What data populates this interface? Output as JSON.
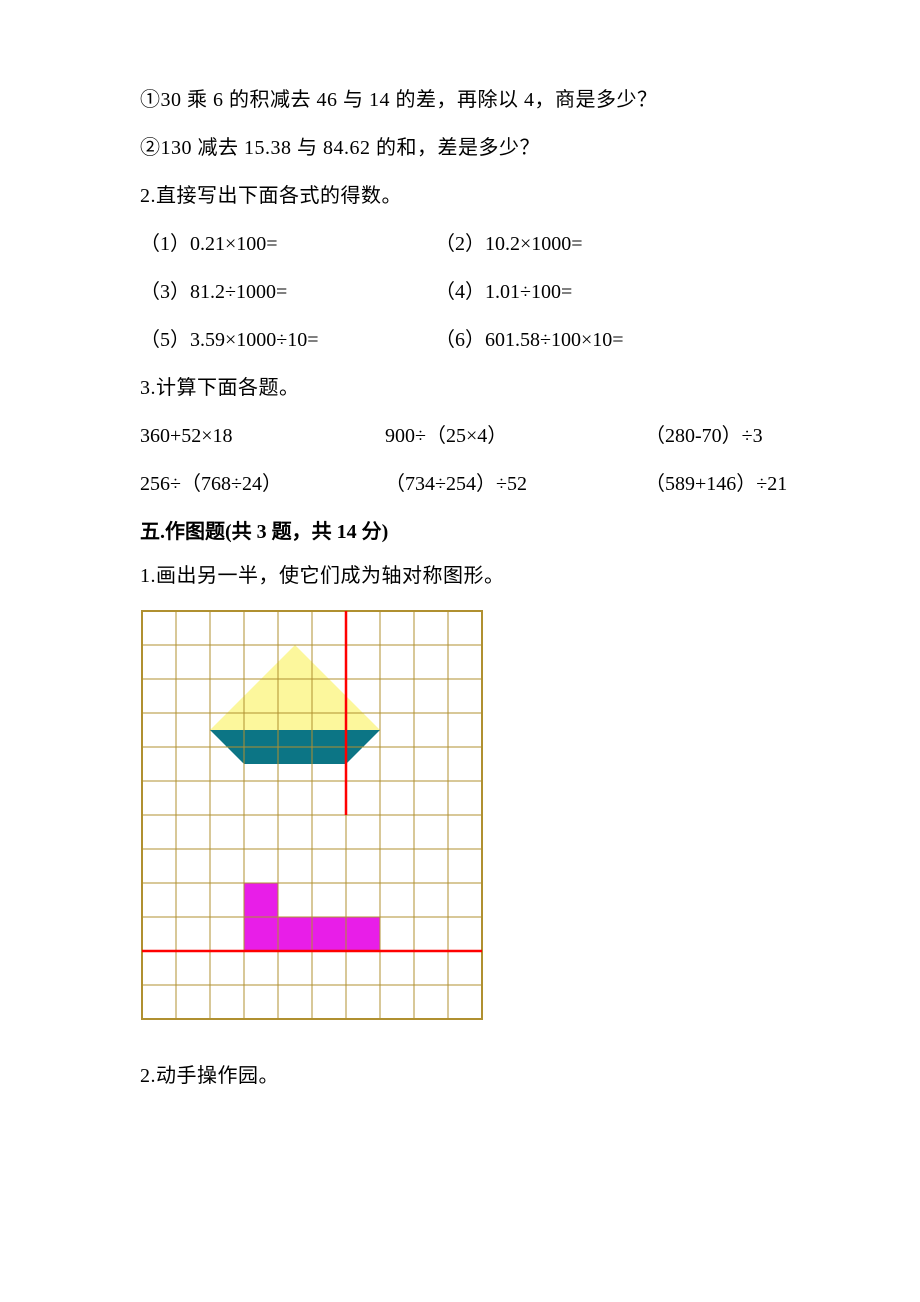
{
  "q1a": "①30 乘 6 的积减去 46 与 14 的差，再除以 4，商是多少？",
  "q1b": "②130 减去 15.38 与 84.62 的和，差是多少？",
  "q2_intro": "2.直接写出下面各式的得数。",
  "q2_1": "（1）0.21×100=",
  "q2_2": "（2）10.2×1000=",
  "q2_3": "（3）81.2÷1000=",
  "q2_4": "（4）1.01÷100=",
  "q2_5": "（5）3.59×1000÷10=",
  "q2_6": "（6）601.58÷100×10=",
  "q3_intro": "3.计算下面各题。",
  "q3_a": "360+52×18",
  "q3_b": "900÷（25×4）",
  "q3_c": "（280-70）÷3",
  "q3_d": "256÷（768÷24）",
  "q3_e": "（734÷254）÷52",
  "q3_f": "（589+146）÷21",
  "section5_heading": "五.作图题(共 3 题，共 14 分)",
  "s5_q1": "1.画出另一半，使它们成为轴对称图形。",
  "s5_q2": "2.动手操作园。",
  "colors": {
    "grid_line": "#b09030",
    "yellow_fill": "#fcf79c",
    "teal_fill": "#0c7585",
    "magenta_fill": "#e81ee8",
    "axis_red": "#ff0000"
  },
  "chart_data": {
    "type": "table",
    "description": "Symmetry drawing grid 10 columns × 12 rows (cell 34px).",
    "shape_A": {
      "note": "Axis of symmetry: vertical red line at column boundary x=6 (from row 0 to row 6).",
      "yellow_triangle_vertices_cells": [
        [
          4.5,
          1
        ],
        [
          2,
          3.5
        ],
        [
          7,
          3.5
        ]
      ],
      "teal_trapezoid_vertices_cells": [
        [
          2,
          3.5
        ],
        [
          7,
          3.5
        ],
        [
          6,
          4.5
        ],
        [
          3,
          4.5
        ]
      ]
    },
    "shape_B": {
      "note": "Axis of symmetry: horizontal red line at row boundary y=10 (from col 0 to col 10).",
      "magenta_cells": [
        [
          3,
          8
        ],
        [
          3,
          9
        ],
        [
          4,
          9
        ],
        [
          5,
          9
        ],
        [
          6,
          9
        ]
      ]
    }
  }
}
